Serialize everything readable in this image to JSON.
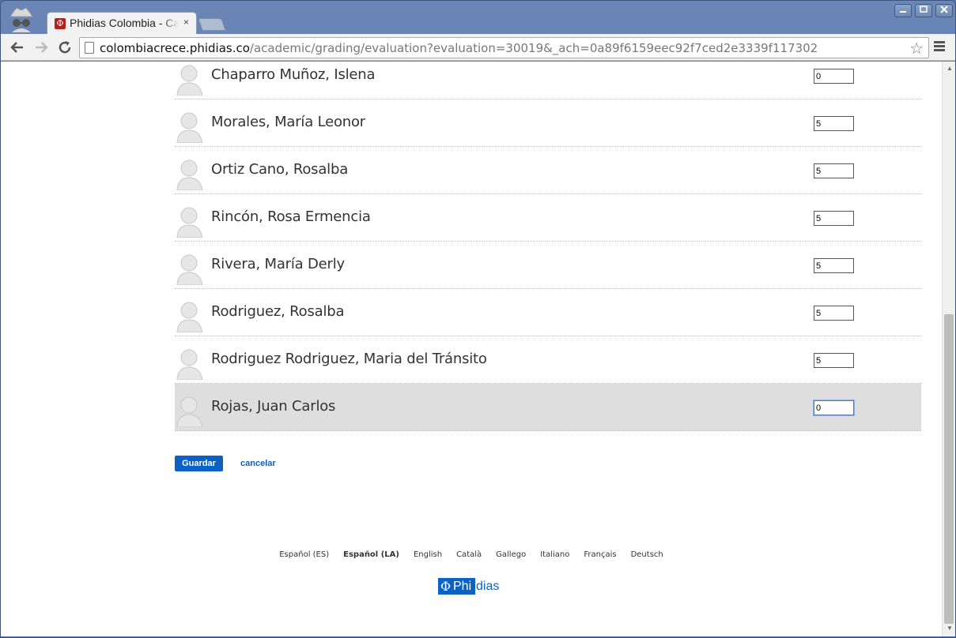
{
  "browser": {
    "tab_title": "Phidias Colombia - Ca",
    "tab_close": "×",
    "tab_favicon": "Φ",
    "url_host": "colombiacrece.phidias.co",
    "url_path": "/academic/grading/evaluation?evaluation=30019&_ach=0a89f6159eec92f7ced2e3339f117302",
    "icons": [
      "incognito-icon",
      "back-icon",
      "forward-icon",
      "reload-icon",
      "page-icon",
      "bookmark-star-icon",
      "menu-icon",
      "minimize-icon",
      "maximize-icon",
      "close-icon"
    ]
  },
  "students": [
    {
      "name": "Chaparro Muñoz, Islena",
      "grade": "0"
    },
    {
      "name": "Morales, María Leonor",
      "grade": "5"
    },
    {
      "name": "Ortiz Cano, Rosalba",
      "grade": "5"
    },
    {
      "name": "Rincón, Rosa Ermencia",
      "grade": "5"
    },
    {
      "name": "Rivera, María Derly",
      "grade": "5"
    },
    {
      "name": "Rodriguez, Rosalba",
      "grade": "5"
    },
    {
      "name": "Rodriguez Rodriguez, Maria del Tránsito",
      "grade": "5"
    },
    {
      "name": "Rojas, Juan Carlos",
      "grade": "0"
    }
  ],
  "actions": {
    "save_label": "Guardar",
    "cancel_label": "cancelar"
  },
  "languages": [
    {
      "label": "Español (ES)",
      "active": false
    },
    {
      "label": "Español (LA)",
      "active": true
    },
    {
      "label": "English",
      "active": false
    },
    {
      "label": "Català",
      "active": false
    },
    {
      "label": "Gallego",
      "active": false
    },
    {
      "label": "Italiano",
      "active": false
    },
    {
      "label": "Français",
      "active": false
    },
    {
      "label": "Deutsch",
      "active": false
    }
  ],
  "footer": {
    "logo_phi": "Φ",
    "logo_highlight": "Phi",
    "logo_rest": "dias"
  },
  "colors": {
    "accent": "#0b62c4",
    "selected_row": "#dedede"
  }
}
